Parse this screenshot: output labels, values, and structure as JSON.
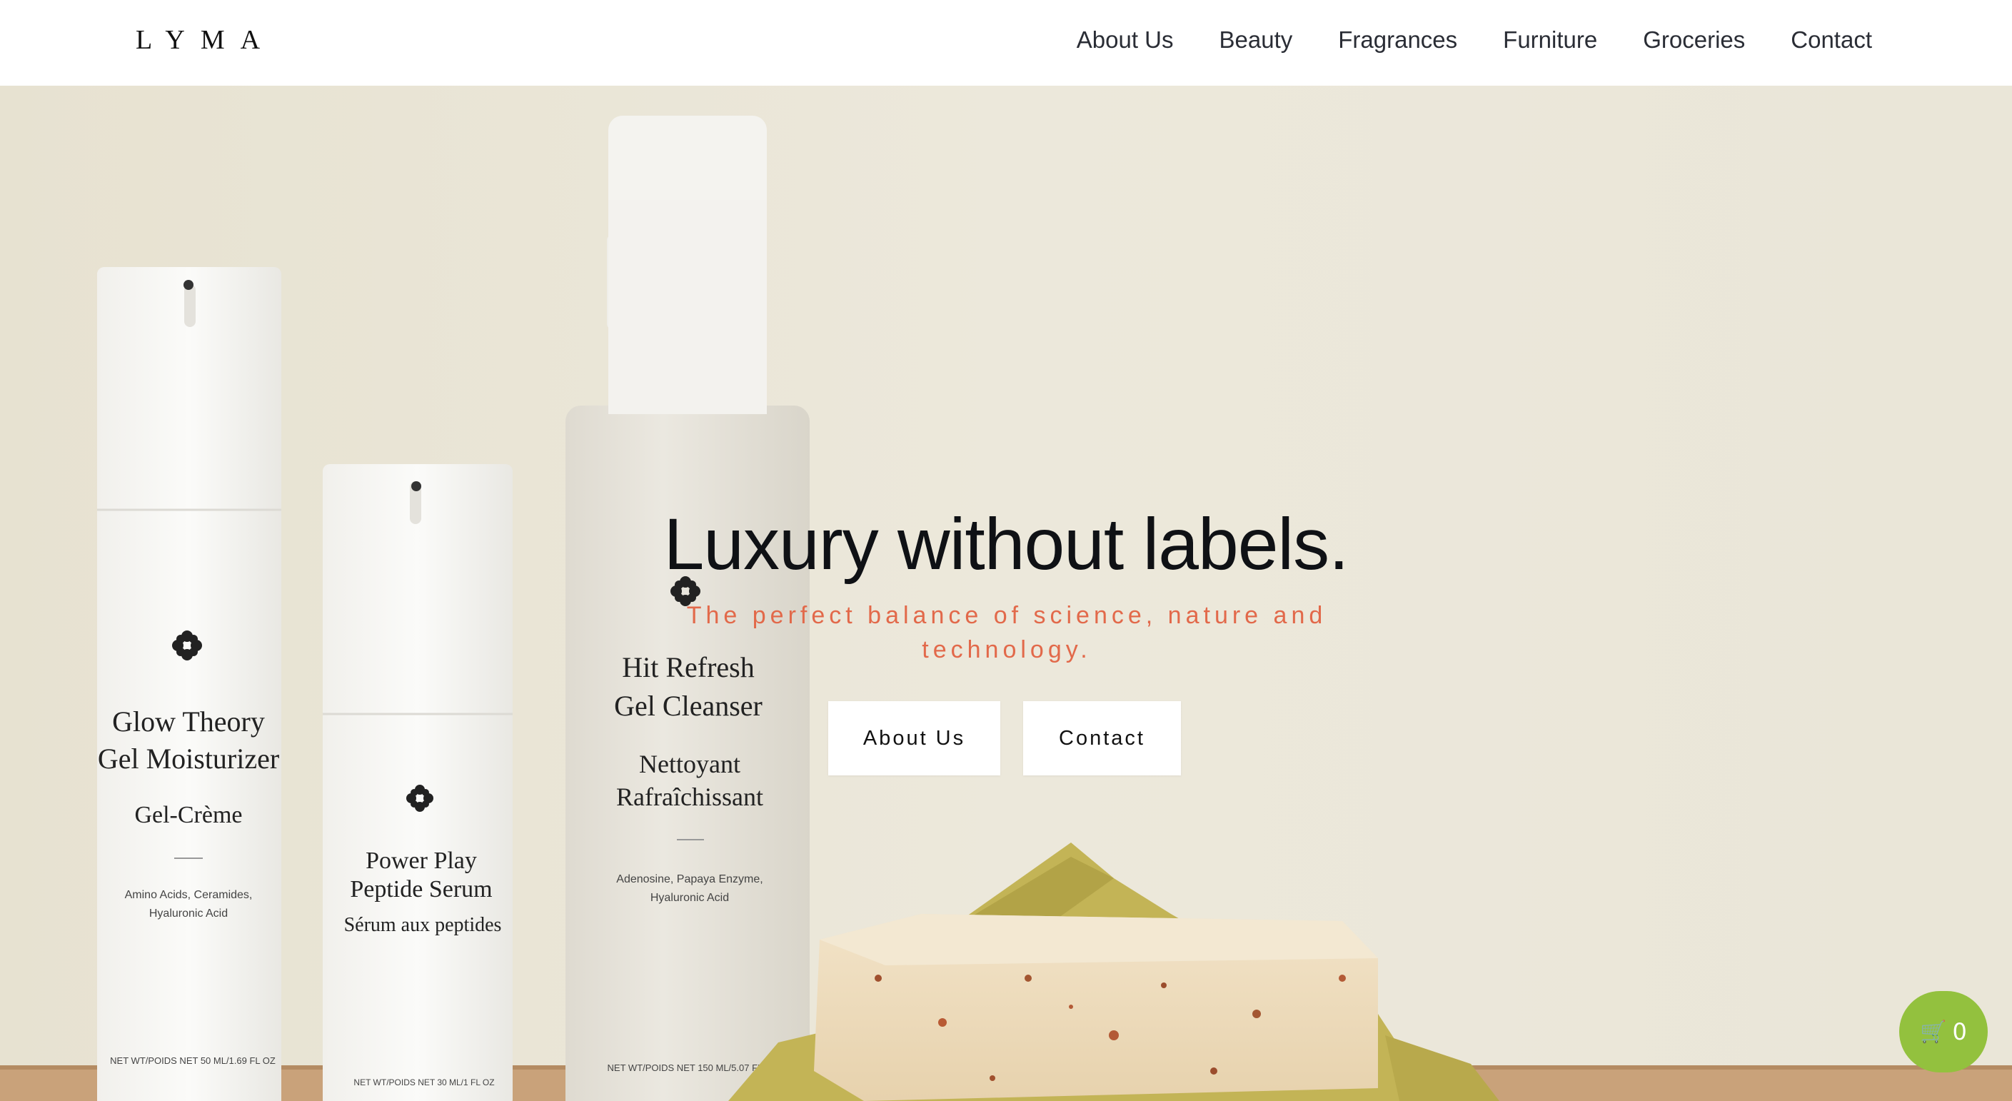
{
  "brand": {
    "logo": "LYMA"
  },
  "nav": {
    "items": [
      "About Us",
      "Beauty",
      "Fragrances",
      "Furniture",
      "Groceries",
      "Contact"
    ]
  },
  "hero": {
    "title": "Luxury without labels.",
    "subtitle": "The perfect balance of science, nature and technology.",
    "buttons": {
      "about": "About Us",
      "contact": "Contact"
    }
  },
  "products": {
    "moisturizer": {
      "name_1": "Glow Theory",
      "name_2": "Gel Moisturizer",
      "fr": "Gel-Crème",
      "ing_1": "Amino Acids, Ceramides,",
      "ing_2": "Hyaluronic Acid",
      "net": "NET WT/POIDS NET 50 ML/1.69 FL OZ"
    },
    "serum": {
      "name_1": "Power Play",
      "name_2": "Peptide Serum",
      "fr": "Sérum aux peptides",
      "net": "NET WT/POIDS NET 30 ML/1 FL OZ"
    },
    "cleanser": {
      "name_1": "Hit Refresh",
      "name_2": "Gel Cleanser",
      "fr_1": "Nettoyant",
      "fr_2": "Rafraîchissant",
      "ing_1": "Adenosine, Papaya Enzyme,",
      "ing_2": "Hyaluronic Acid",
      "net": "NET WT/POIDS NET 150 ML/5.07 FL OZ"
    }
  },
  "cart": {
    "icon": "cart-icon",
    "count": "0"
  },
  "colors": {
    "accent": "#e2694a",
    "cart": "#93c13e",
    "text": "#0f1115"
  }
}
